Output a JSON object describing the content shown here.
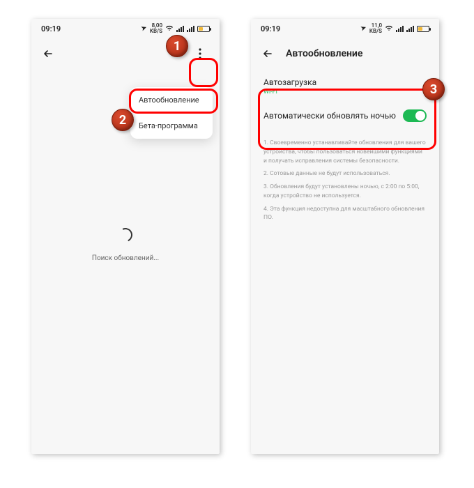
{
  "left": {
    "status": {
      "time": "09:19",
      "speed_top": "8,00",
      "speed_bottom": "KB/S",
      "wifi": true,
      "battery_pct": 35
    },
    "more_menu": {
      "item1": "Автообновление",
      "item2": "Бета-программа"
    },
    "loading": "Поиск обновлений..."
  },
  "right": {
    "status": {
      "time": "09:19",
      "speed_top": "11,0",
      "speed_bottom": "KB/S",
      "battery_pct": 35
    },
    "title": "Автообновление",
    "setting1": {
      "title": "Автозагрузка",
      "sub": "Wi-Fi"
    },
    "setting2": {
      "title": "Автоматически обновлять ночью",
      "on": true
    },
    "info": {
      "p1": "1. Своевременно устанавливайте обновления для вашего устройства, чтобы пользоваться новейшими функциями и получать исправления системы безопасности.",
      "p2": "2. Сотовые данные не будут использоваться.",
      "p3": "3. Обновления будут установлены ночью, с 2:00 по 5:00, когда устройство не используется.",
      "p4": "4. Эта функция недоступна для масштабного обновления ПО."
    }
  },
  "badges": {
    "b1": "1",
    "b2": "2",
    "b3": "3"
  }
}
